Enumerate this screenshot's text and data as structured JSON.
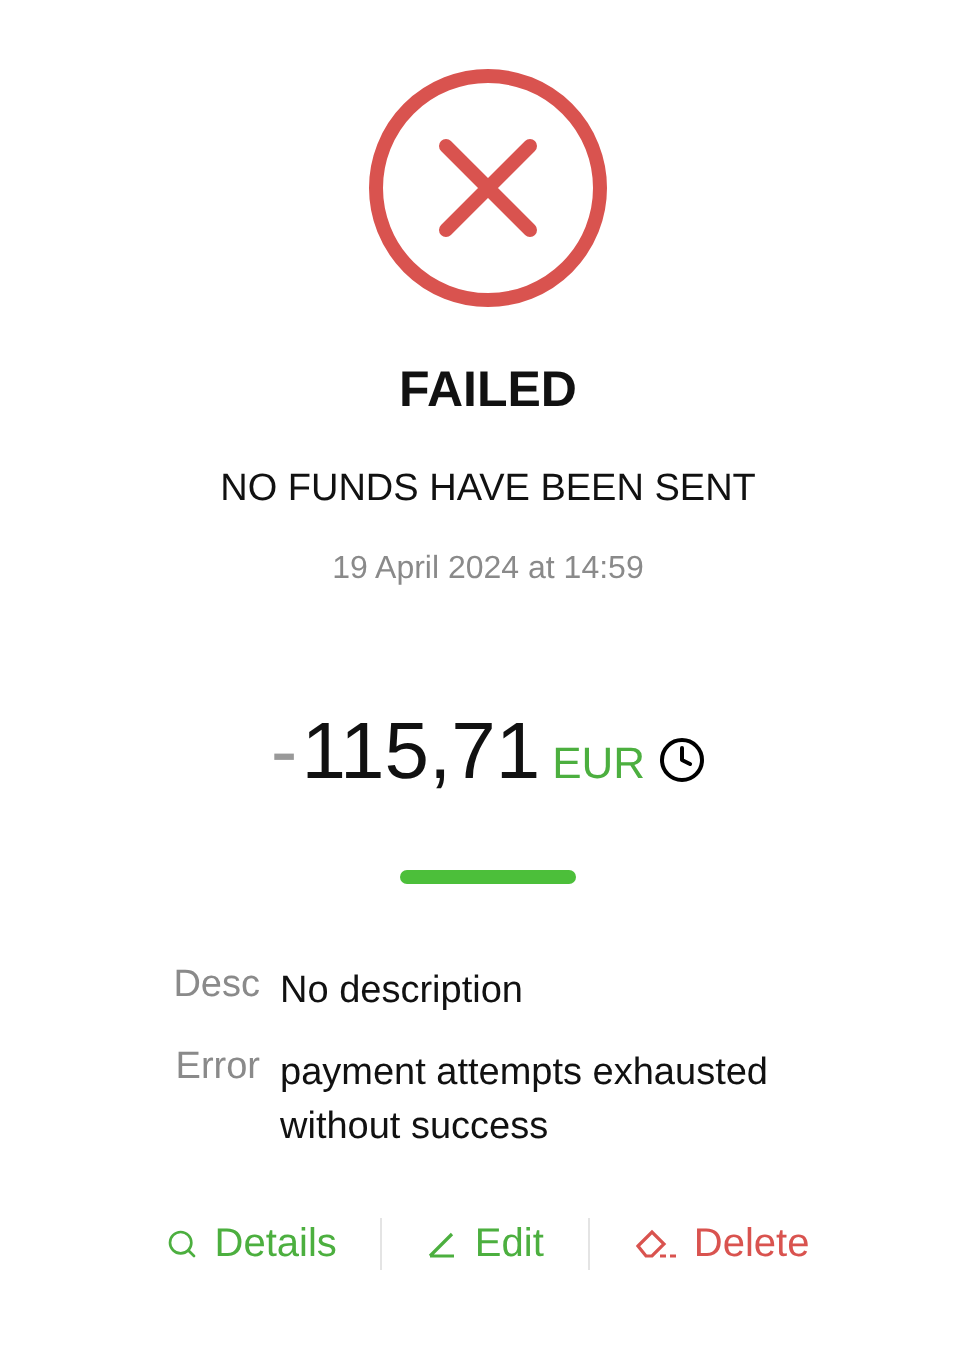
{
  "status": {
    "kind": "failed",
    "title": "FAILED",
    "subtitle": "NO FUNDS HAVE BEEN SENT",
    "date": "19 April 2024 at 14:59"
  },
  "amount": {
    "sign": "-",
    "value": "115,71",
    "currency": "EUR",
    "pending": true
  },
  "fields": [
    {
      "label": "Desc",
      "value": "No description"
    },
    {
      "label": "Error",
      "value": "payment attempts exhausted without success"
    }
  ],
  "actions": [
    {
      "kind": "details",
      "label": "Details"
    },
    {
      "kind": "edit",
      "label": "Edit"
    },
    {
      "kind": "delete",
      "label": "Delete"
    }
  ]
}
